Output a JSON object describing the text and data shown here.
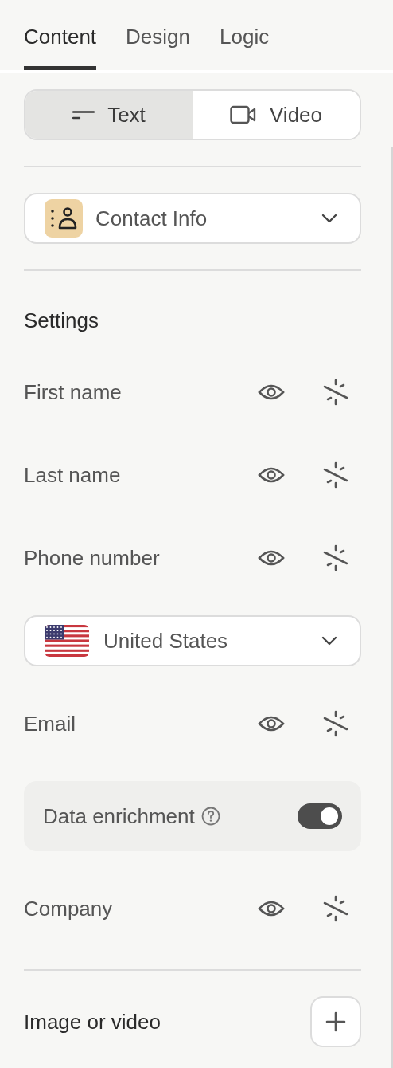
{
  "tabs": [
    {
      "label": "Content",
      "selected": true
    },
    {
      "label": "Design",
      "selected": false
    },
    {
      "label": "Logic",
      "selected": false
    }
  ],
  "mode_switch": [
    {
      "label": "Text",
      "kind": "text",
      "selected": true
    },
    {
      "label": "Video",
      "kind": "video",
      "selected": false
    }
  ],
  "block_type": {
    "label": "Contact Info"
  },
  "settings": {
    "title": "Settings",
    "items": [
      {
        "kind": "field",
        "label": "First name"
      },
      {
        "kind": "field",
        "label": "Last name"
      },
      {
        "kind": "field",
        "label": "Phone number"
      },
      {
        "kind": "country",
        "label": "United States"
      },
      {
        "kind": "field",
        "label": "Email"
      },
      {
        "kind": "toggle",
        "label": "Data enrichment",
        "on": true
      },
      {
        "kind": "field",
        "label": "Company"
      }
    ]
  },
  "media": {
    "title": "Image or video"
  }
}
